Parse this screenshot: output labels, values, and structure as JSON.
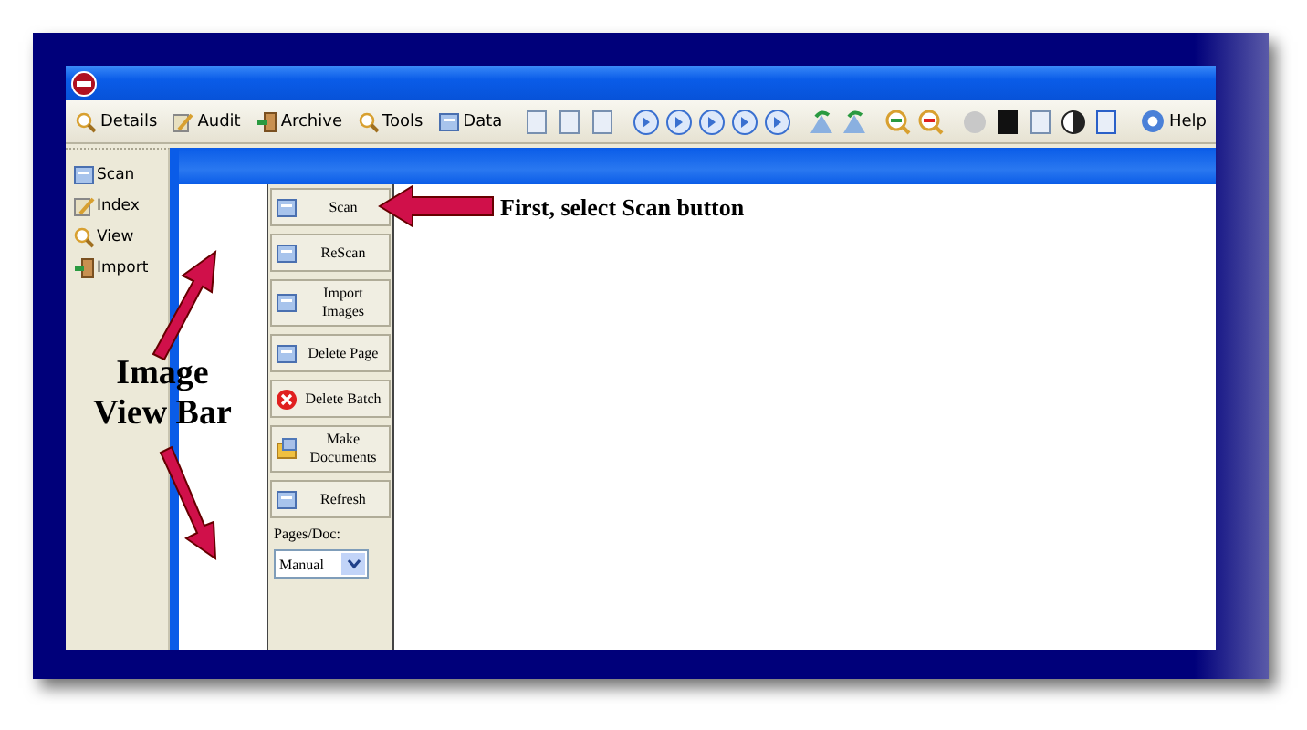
{
  "toolbar": {
    "labeled": [
      "Details",
      "Audit",
      "Archive",
      "Tools",
      "Data"
    ],
    "help": "Help"
  },
  "nav": {
    "items": [
      {
        "label": "Scan"
      },
      {
        "label": "Index"
      },
      {
        "label": "View"
      },
      {
        "label": "Import"
      }
    ]
  },
  "panel": {
    "buttons": [
      {
        "label": "Scan",
        "kind": "page"
      },
      {
        "label": "ReScan",
        "kind": "page"
      },
      {
        "label": "Import Images",
        "kind": "page"
      },
      {
        "label": "Delete Page",
        "kind": "page"
      },
      {
        "label": "Delete Batch",
        "kind": "delete"
      },
      {
        "label": "Make Documents",
        "kind": "folder"
      },
      {
        "label": "Refresh",
        "kind": "page"
      }
    ],
    "pages_label": "Pages/Doc:",
    "pages_value": "Manual"
  },
  "annotations": {
    "callout": "First, select Scan button",
    "bar_label": "Image View Bar"
  }
}
